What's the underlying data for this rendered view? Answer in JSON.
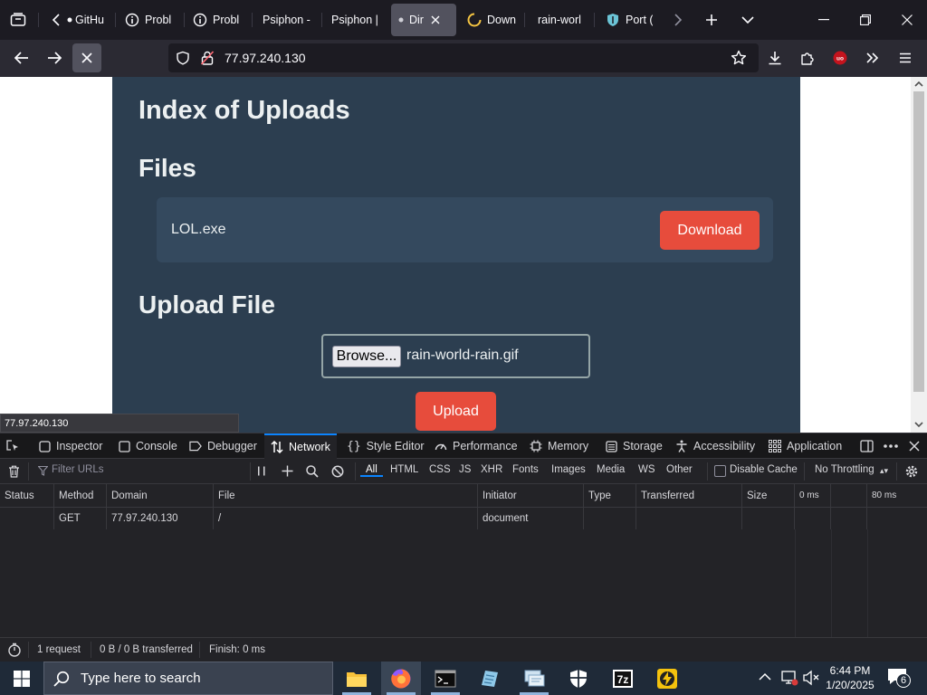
{
  "browser": {
    "tabs": [
      {
        "label": "GitHu",
        "icon": "github-icon"
      },
      {
        "label": "Probl",
        "icon": "info-circle-icon"
      },
      {
        "label": "Probl",
        "icon": "info-circle-icon"
      },
      {
        "label": "Psiphon -",
        "icon": ""
      },
      {
        "label": "Psiphon |",
        "icon": ""
      },
      {
        "label": "Dir",
        "icon": "dot-icon"
      },
      {
        "label": "Down",
        "icon": "loading-icon"
      },
      {
        "label": "rain-worl",
        "icon": ""
      },
      {
        "label": "Port (",
        "icon": "shield-icon"
      }
    ],
    "url": "77.97.240.130",
    "status_url": "77.97.240.130"
  },
  "page": {
    "title": "Index of Uploads",
    "files_heading": "Files",
    "file_name": "LOL.exe",
    "download_label": "Download",
    "upload_heading": "Upload File",
    "browse_label": "Browse...",
    "selected_file": "rain-world-rain.gif",
    "upload_label": "Upload",
    "colors": {
      "panel": "#2c3e50",
      "button": "#e74c3c"
    }
  },
  "devtools": {
    "tabs": [
      "Inspector",
      "Console",
      "Debugger",
      "Network",
      "Style Editor",
      "Performance",
      "Memory",
      "Storage",
      "Accessibility",
      "Application"
    ],
    "active_tab": "Network",
    "filter_placeholder": "Filter URLs",
    "filter_types": [
      "All",
      "HTML",
      "CSS",
      "JS",
      "XHR",
      "Fonts",
      "Images",
      "Media",
      "WS",
      "Other"
    ],
    "disable_cache": "Disable Cache",
    "throttling": "No Throttling",
    "columns": [
      "Status",
      "Method",
      "Domain",
      "File",
      "Initiator",
      "Type",
      "Transferred",
      "Size",
      "0 ms",
      "80 ms"
    ],
    "rows": [
      {
        "status": "",
        "method": "GET",
        "domain": "77.97.240.130",
        "file": "/",
        "initiator": "document",
        "type": "",
        "transferred": "",
        "size": ""
      }
    ],
    "summary": {
      "requests": "1 request",
      "transferred": "0 B / 0 B transferred",
      "finish": "Finish: 0 ms"
    }
  },
  "taskbar": {
    "search_placeholder": "Type here to search",
    "time": "6:44 PM",
    "date": "1/20/2025",
    "notification_count": "6"
  }
}
